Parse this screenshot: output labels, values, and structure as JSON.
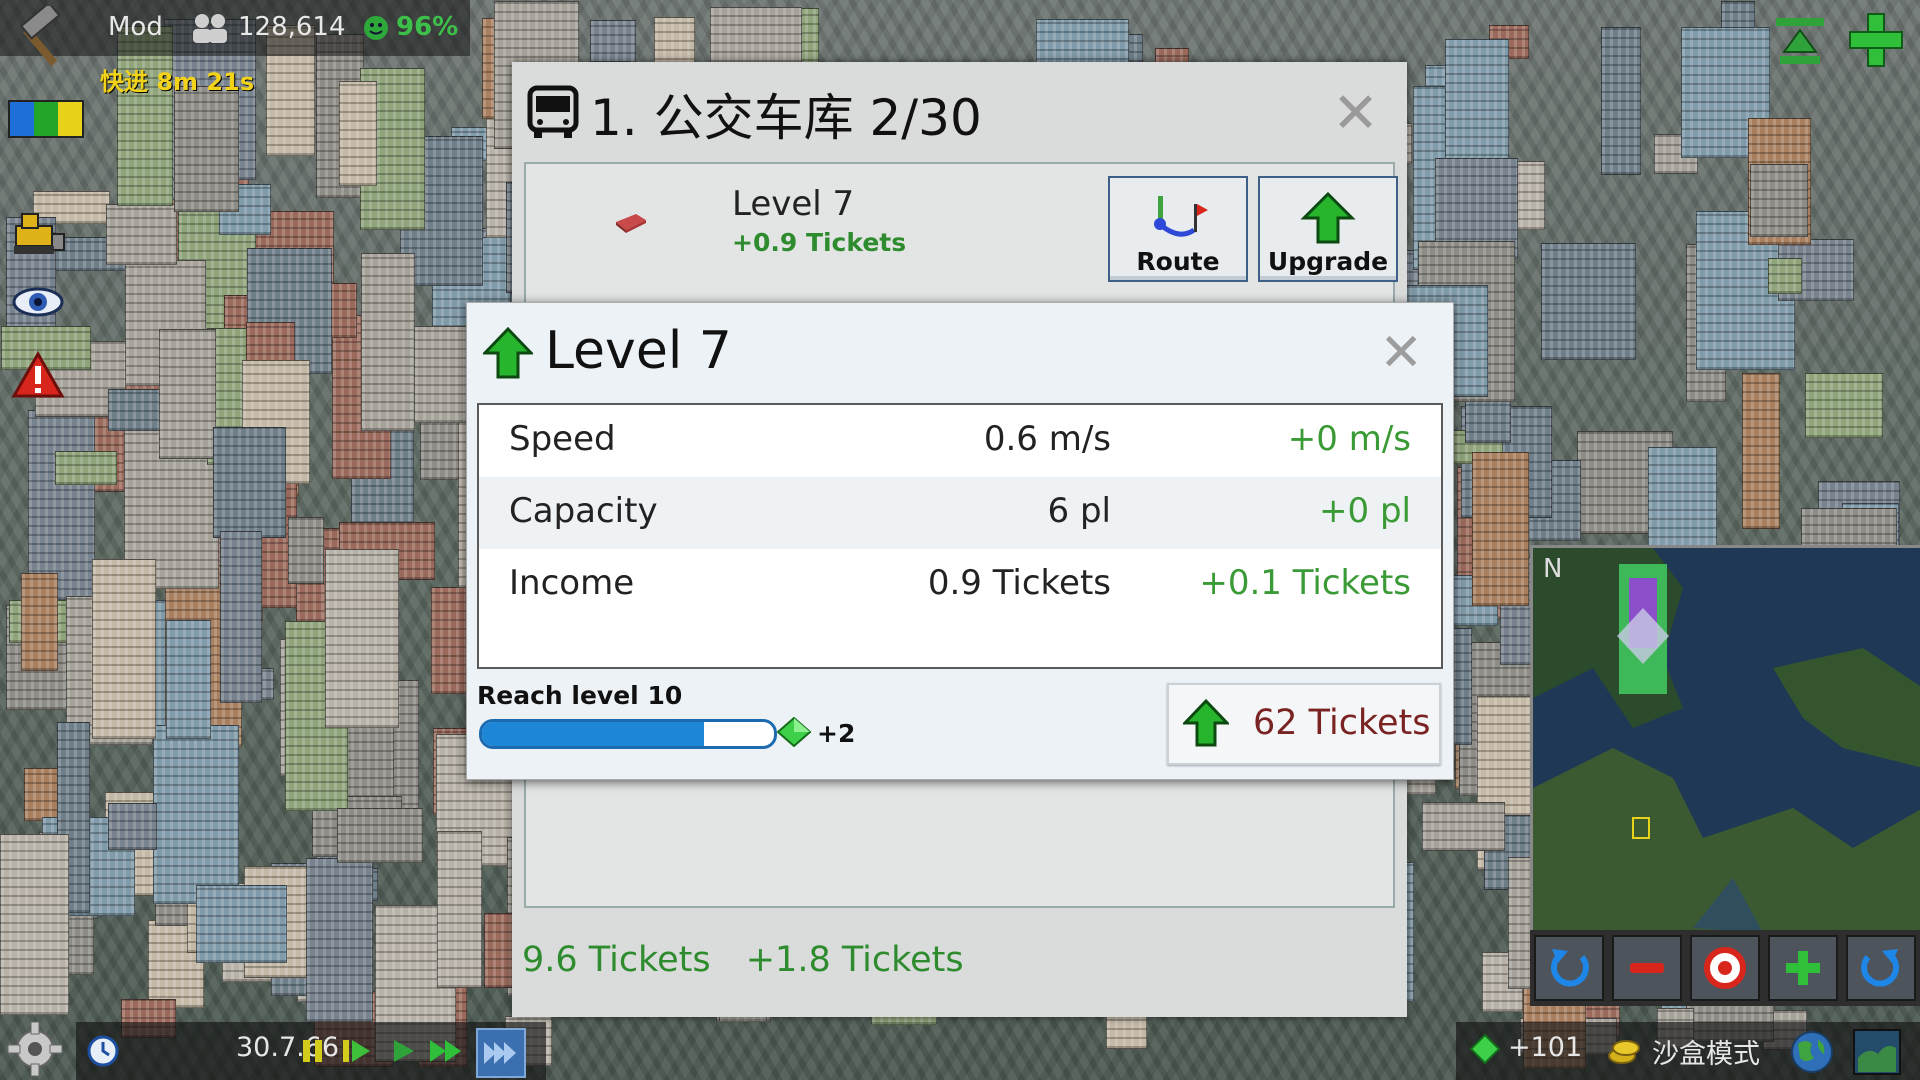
{
  "hud": {
    "mod_label": "Mod",
    "population": "128,614",
    "happiness": "96%",
    "fast_forward": "快进 8m 21s",
    "colors": {
      "blue": "#1e6fd8",
      "green": "#23a52a",
      "yellow": "#e8d21a"
    }
  },
  "depot": {
    "title": "1. 公交车库 2/30",
    "vehicle": {
      "level": "Level 7",
      "tickets": "+0.9 Tickets"
    },
    "buttons": {
      "route": "Route",
      "upgrade": "Upgrade"
    },
    "footer": {
      "total": "9.6 Tickets",
      "delta": "+1.8 Tickets"
    }
  },
  "level_dialog": {
    "title": "Level 7",
    "stats": [
      {
        "label": "Speed",
        "value": "0.6 m/s",
        "delta": "+0 m/s"
      },
      {
        "label": "Capacity",
        "value": "6 pl",
        "delta": "+0 pl"
      },
      {
        "label": "Income",
        "value": "0.9 Tickets",
        "delta": "+0.1 Tickets"
      }
    ],
    "reach_label": "Reach level 10",
    "progress": 0.76,
    "gem_reward": "+2",
    "upgrade_cost": "62 Tickets"
  },
  "minimap": {
    "north": "N"
  },
  "bottom": {
    "date": "30.7.66",
    "gems": "+101",
    "mode": "沙盒模式"
  }
}
